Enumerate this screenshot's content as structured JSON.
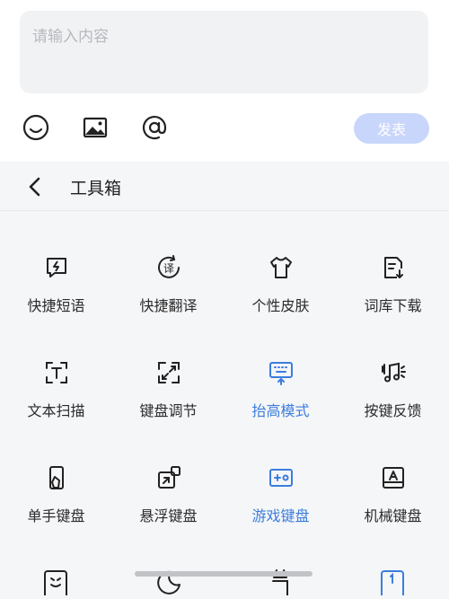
{
  "composer": {
    "placeholder": "请输入内容",
    "send_label": "发表",
    "tools": [
      {
        "icon": "emoji-icon"
      },
      {
        "icon": "image-icon"
      },
      {
        "icon": "at-icon"
      }
    ]
  },
  "toolbox": {
    "title": "工具箱",
    "items": [
      {
        "label": "快捷短语",
        "icon": "quick-phrase-icon",
        "active": false
      },
      {
        "label": "快捷翻译",
        "icon": "translate-icon",
        "active": false
      },
      {
        "label": "个性皮肤",
        "icon": "skin-icon",
        "active": false
      },
      {
        "label": "词库下载",
        "icon": "dictionary-download-icon",
        "active": false
      },
      {
        "label": "文本扫描",
        "icon": "text-scan-icon",
        "active": false
      },
      {
        "label": "键盘调节",
        "icon": "keyboard-resize-icon",
        "active": false
      },
      {
        "label": "抬高模式",
        "icon": "raise-mode-icon",
        "active": true
      },
      {
        "label": "按键反馈",
        "icon": "key-feedback-icon",
        "active": false
      },
      {
        "label": "单手键盘",
        "icon": "one-hand-keyboard-icon",
        "active": false
      },
      {
        "label": "悬浮键盘",
        "icon": "floating-keyboard-icon",
        "active": false
      },
      {
        "label": "游戏键盘",
        "icon": "game-keyboard-icon",
        "active": true
      },
      {
        "label": "机械键盘",
        "icon": "mechanical-keyboard-icon",
        "active": false
      }
    ]
  },
  "colors": {
    "accent": "#3b7ddd",
    "send_disabled": "#c9d6fb",
    "input_bg": "#f1f2f4"
  }
}
